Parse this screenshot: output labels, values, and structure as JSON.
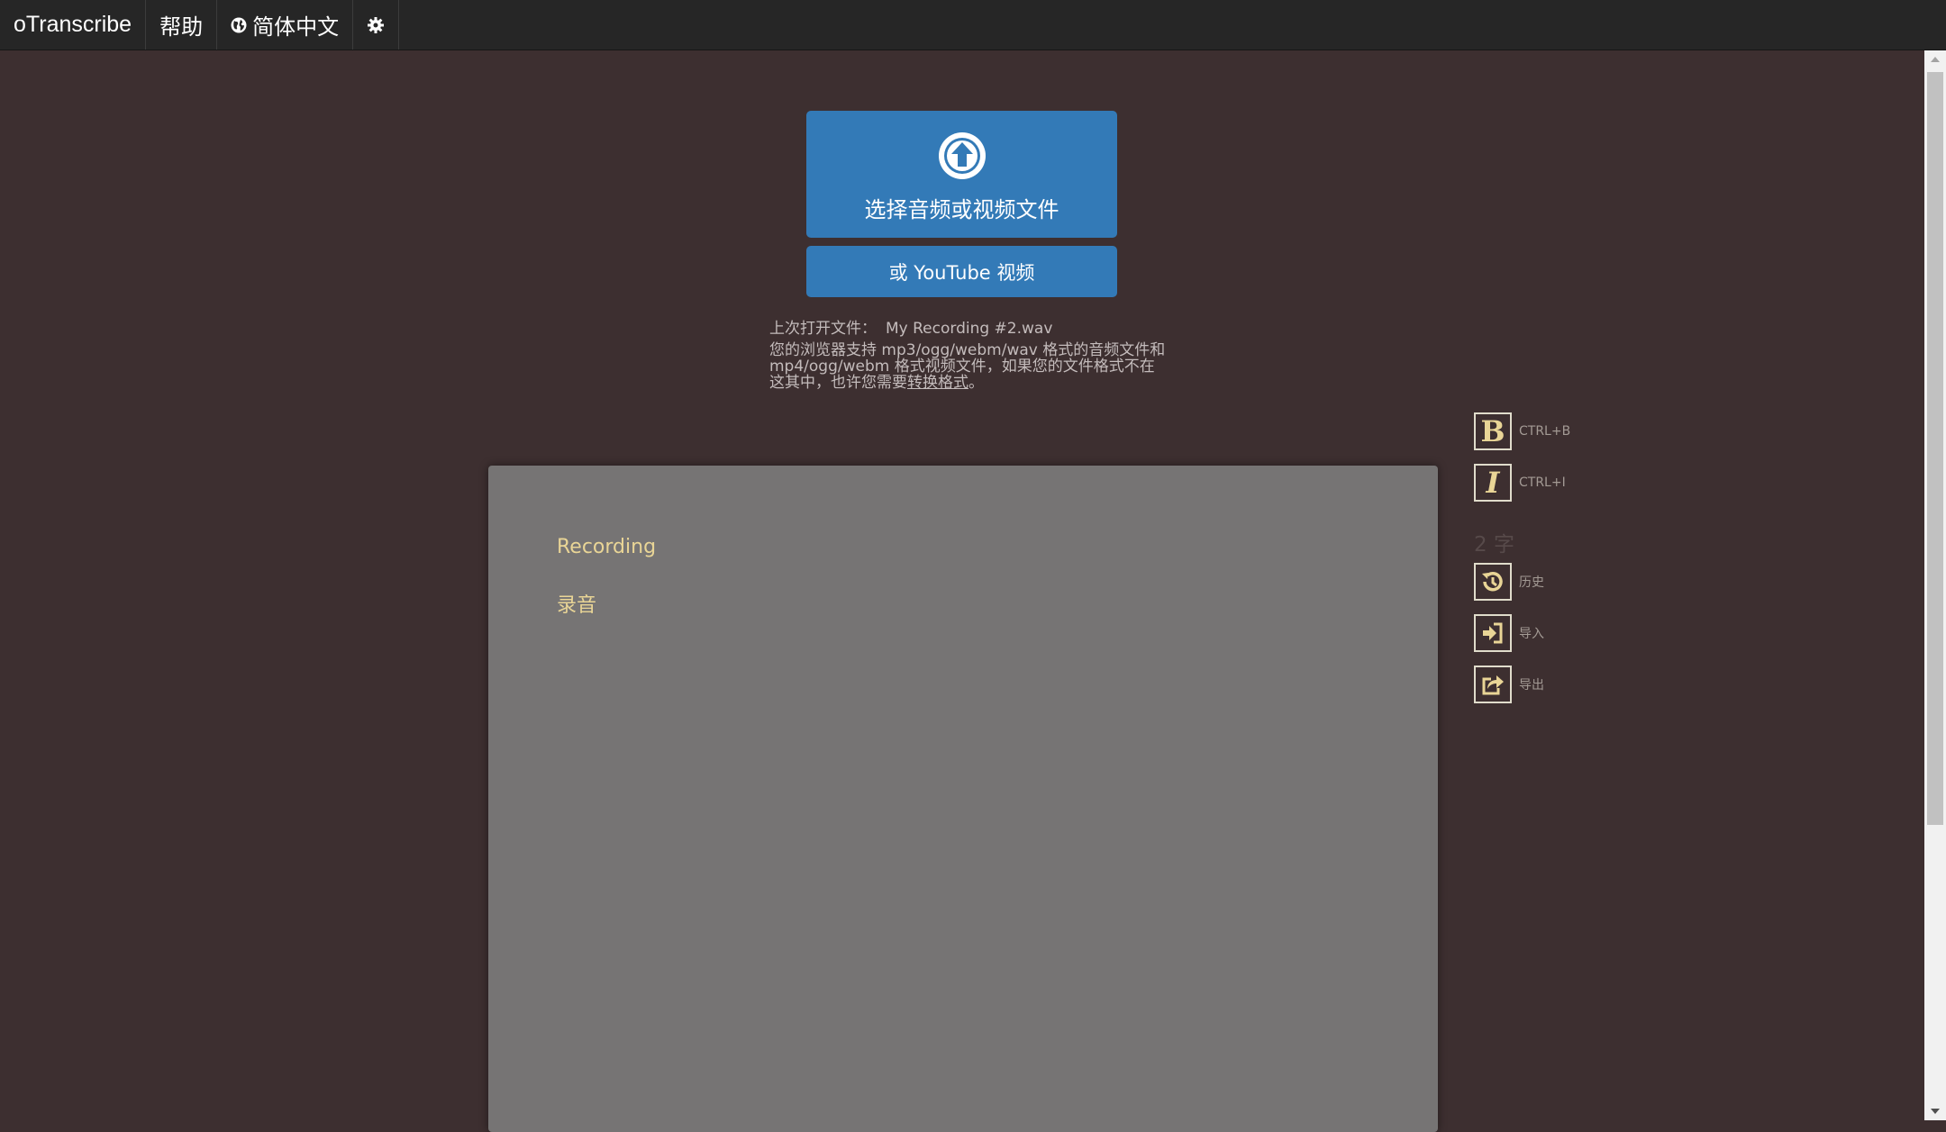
{
  "nav": {
    "brand": "oTranscribe",
    "help": "帮助",
    "language": "简体中文"
  },
  "upload": {
    "label": "选择音频或视频文件",
    "youtube_label": "或 YouTube 视频"
  },
  "file_info": {
    "last_opened_prefix": "上次打开文件：",
    "last_opened_name": "My Recording #2.wav",
    "support_text": "您的浏览器支持 mp3/ogg/webm/wav 格式的音频文件和 mp4/ogg/webm 格式视频文件，如果您的文件格式不在这其中，也许您需要",
    "convert_link": "转换格式",
    "end_punct": "。"
  },
  "editor": {
    "lines": [
      "Recording",
      "录音"
    ]
  },
  "tools": {
    "bold_glyph": "B",
    "bold_shortcut": "CTRL+B",
    "italic_glyph": "I",
    "italic_shortcut": "CTRL+I",
    "word_count": "2 字",
    "history_label": "历史",
    "import_label": "导入",
    "export_label": "导出"
  },
  "colors": {
    "background": "#3d2f30",
    "navbar": "#262626",
    "primary_button": "#337ab7",
    "editor_bg": "#767474",
    "editor_text": "#e9d596"
  },
  "icons": [
    "upload-circle-icon",
    "globe-icon",
    "gear-icon",
    "history-icon",
    "import-icon",
    "export-icon"
  ]
}
